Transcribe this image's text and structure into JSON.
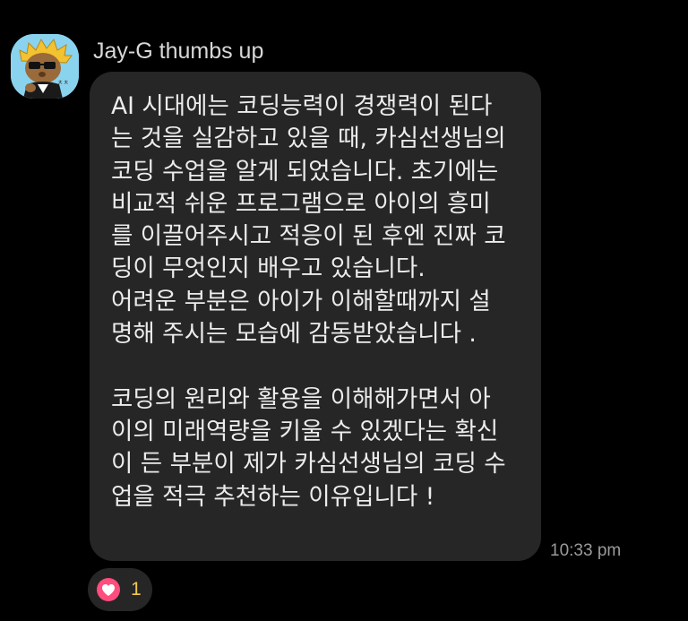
{
  "message": {
    "sender_name": "Jay-G thumbs up",
    "text": "AI 시대에는 코딩능력이 경쟁력이 된다\n는 것을 실감하고 있을 때, 카심선생님의\n코딩 수업을 알게 되었습니다. 초기에는\n비교적 쉬운 프로그램으로 아이의 흥미\n를 이끌어주시고 적응이 된 후엔 진짜 코\n딩이 무엇인지 배우고 있습니다.\n어려운 부분은 아이가 이해할때까지 설\n명해 주시는 모습에 감동받았습니다 .\n\n코딩의 원리와 활용을 이해해가면서 아\n이의 미래역량을 키울 수 있겠다는 확신\n이 든 부분이 제가 카심선생님의 코딩 수\n업을 적극 추천하는 이유입니다 !",
    "timestamp": "10:33 pm"
  },
  "reaction": {
    "icon": "heart-icon",
    "count": "1",
    "color": "#ff4d7d"
  },
  "avatar": {
    "icon": "cartoon-avatar-icon",
    "background": "#8ad3ee"
  }
}
